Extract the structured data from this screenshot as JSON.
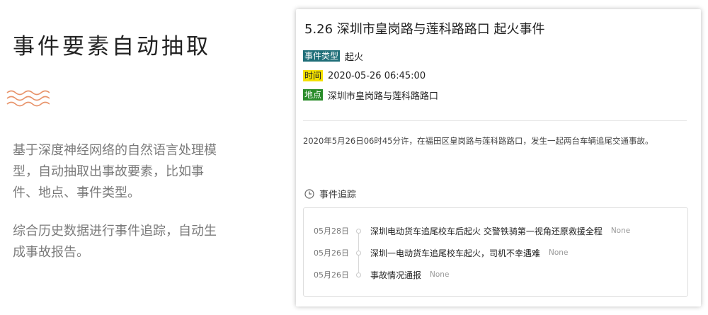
{
  "intro": {
    "title": "事件要素自动抽取",
    "paragraph1": "基于深度神经网络的自然语言处理模型，自动抽取出事故要素，比如事件、地点、事件类型。",
    "paragraph2": "综合历史数据进行事件追踪，自动生成事故报告。"
  },
  "card": {
    "title": "5.26 深圳市皇岗路与莲科路路口 起火事件",
    "fields": [
      {
        "tag": "事件类型",
        "value": "起火"
      },
      {
        "tag": "时间",
        "value": "2020-05-26 06:45:00"
      },
      {
        "tag": "地点",
        "value": "深圳市皇岗路与莲科路路口"
      }
    ],
    "summary": "2020年5月26日06时45分许，在福田区皇岗路与莲科路路口，发生一起两台车辆追尾交通事故。",
    "tracking": {
      "title": "事件追踪",
      "items": [
        {
          "date": "05月28日",
          "text": "深圳电动货车追尾校车后起火 交警铁骑第一视角还原救援全程",
          "source": "None"
        },
        {
          "date": "05月26日",
          "text": "深圳一电动货车追尾校车起火，司机不幸遇难",
          "source": "None"
        },
        {
          "date": "05月26日",
          "text": "事故情况通报",
          "source": "None"
        }
      ]
    }
  },
  "colors": {
    "tag_type": "#1f6e78",
    "tag_time": "#f4e100",
    "tag_place": "#2a8c2a",
    "wave_accent": "#e8936a"
  }
}
